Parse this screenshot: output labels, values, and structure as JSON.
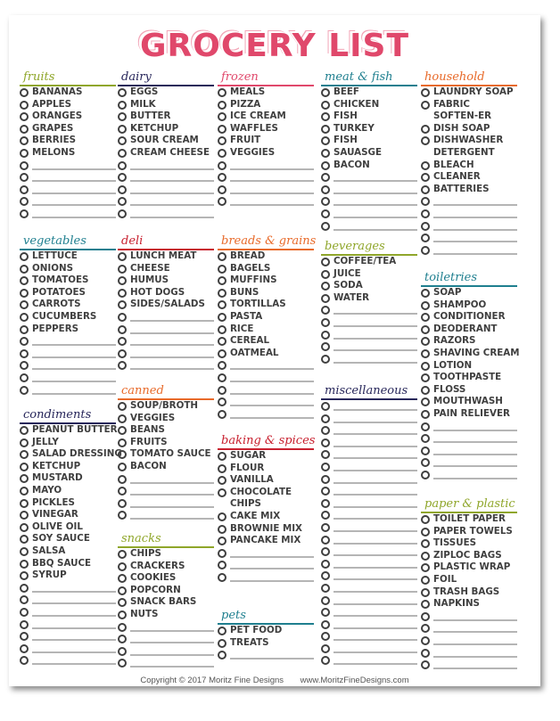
{
  "title": "GROCERY LIST",
  "colors": {
    "title": "#e0486b",
    "green": "#8fa62a",
    "navy": "#27265a",
    "pink": "#e0486b",
    "teal": "#1f7f8f",
    "orange": "#e86a2a",
    "red": "#c8202f",
    "purple": "#4a4a8a"
  },
  "sections": [
    {
      "id": "fruits",
      "heading": "fruits",
      "color": "#8fa62a",
      "items": [
        "BANANAS",
        "APPLES",
        "ORANGES",
        "GRAPES",
        "BERRIES",
        "MELONS"
      ],
      "blank_lines": 5
    },
    {
      "id": "dairy",
      "heading": "dairy",
      "color": "#27265a",
      "items": [
        "EGGS",
        "MILK",
        "BUTTER",
        "KETCHUP",
        "SOUR CREAM",
        "CREAM CHEESE"
      ],
      "blank_lines": 5
    },
    {
      "id": "frozen",
      "heading": "frozen",
      "color": "#e0486b",
      "items": [
        "MEALS",
        "PIZZA",
        "ICE CREAM",
        "WAFFLES",
        "FRUIT",
        "VEGGIES"
      ],
      "blank_lines": 4
    },
    {
      "id": "meat-fish",
      "heading": "meat & fish",
      "color": "#1f7f8f",
      "items": [
        "BEEF",
        "CHICKEN",
        "FISH",
        "TURKEY",
        "FISH",
        "SAUASGE",
        "BACON"
      ],
      "blank_lines": 5
    },
    {
      "id": "household",
      "heading": "household",
      "color": "#e86a2a",
      "items": [
        "LAUNDRY SOAP",
        "FABRIC SOFTEN-ER",
        "DISH SOAP",
        "DISHWASHER DETERGENT",
        "BLEACH",
        "CLEANER",
        "BATTERIES"
      ],
      "blank_lines": 5
    },
    {
      "id": "vegetables",
      "heading": "vegetables",
      "color": "#1f7f8f",
      "items": [
        "LETTUCE",
        "ONIONS",
        "TOMATOES",
        "POTATOES",
        "CARROTS",
        "CUCUMBERS",
        "PEPPERS"
      ],
      "blank_lines": 5
    },
    {
      "id": "deli",
      "heading": "deli",
      "color": "#c8202f",
      "items": [
        "LUNCH MEAT",
        "CHEESE",
        "HUMUS",
        "HOT DOGS",
        "SIDES/SALADS"
      ],
      "blank_lines": 5
    },
    {
      "id": "breads-grains",
      "heading": "breads & grains",
      "color": "#e86a2a",
      "items": [
        "BREAD",
        "BAGELS",
        "MUFFINS",
        "BUNS",
        "TORTILLAS",
        "PASTA",
        "RICE",
        "CEREAL",
        "OATMEAL"
      ],
      "blank_lines": 5
    },
    {
      "id": "beverages",
      "heading": "beverages",
      "color": "#8fa62a",
      "items": [
        "COFFEE/TEA",
        "JUICE",
        "SODA",
        "WATER"
      ],
      "blank_lines": 5
    },
    {
      "id": "toiletries",
      "heading": "toiletries",
      "color": "#1f7f8f",
      "items": [
        "SOAP",
        "SHAMPOO",
        "CONDITIONER",
        "DEODERANT",
        "RAZORS",
        "SHAVING CREAM",
        "LOTION",
        "TOOTHPASTE",
        "FLOSS",
        "MOUTHWASH",
        "PAIN RELIEVER"
      ],
      "blank_lines": 5
    },
    {
      "id": "canned",
      "heading": "canned",
      "color": "#e86a2a",
      "items": [
        "SOUP/BROTH",
        "VEGGIES",
        "BEANS",
        "FRUITS",
        "TOMATO SAUCE",
        "BACON"
      ],
      "blank_lines": 4
    },
    {
      "id": "condiments",
      "heading": "condiments",
      "color": "#27265a",
      "items": [
        "PEANUT BUTTER",
        "JELLY",
        "SALAD DRESSING",
        "KETCHUP",
        "MUSTARD",
        "MAYO",
        "PICKLES",
        "VINEGAR",
        "OLIVE OIL",
        "SOY SAUCE",
        "SALSA",
        "BBQ SAUCE",
        "SYRUP"
      ],
      "blank_lines": 7
    },
    {
      "id": "miscellaneous",
      "heading": "miscellaneous",
      "color": "#27265a",
      "items": [],
      "blank_lines": 22
    },
    {
      "id": "baking-spices",
      "heading": "baking & spices",
      "color": "#c8202f",
      "items": [
        "SUGAR",
        "FLOUR",
        "VANILLA",
        "CHOCOLATE CHIPS",
        "CAKE MIX",
        "BROWNIE MIX",
        "PANCAKE MIX"
      ],
      "blank_lines": 3
    },
    {
      "id": "snacks",
      "heading": "snacks",
      "color": "#8fa62a",
      "items": [
        "CHIPS",
        "CRACKERS",
        "COOKIES",
        "POPCORN",
        "SNACK BARS",
        "NUTS"
      ],
      "blank_lines": 4
    },
    {
      "id": "paper-plastic",
      "heading": "paper & plastic",
      "color": "#8fa62a",
      "items": [
        "TOILET PAPER",
        "PAPER TOWELS",
        "TISSUES",
        "ZIPLOC BAGS",
        "PLASTIC WRAP",
        "FOIL",
        "TRASH BAGS",
        "NAPKINS"
      ],
      "blank_lines": 5
    },
    {
      "id": "pets",
      "heading": "pets",
      "color": "#1f7f8f",
      "items": [
        "PET FOOD",
        "TREATS"
      ],
      "blank_lines": 1
    }
  ],
  "footer": {
    "copyright": "Copyright © 2017 Moritz Fine Designs",
    "website": "www.MoritzFineDesigns.com"
  }
}
